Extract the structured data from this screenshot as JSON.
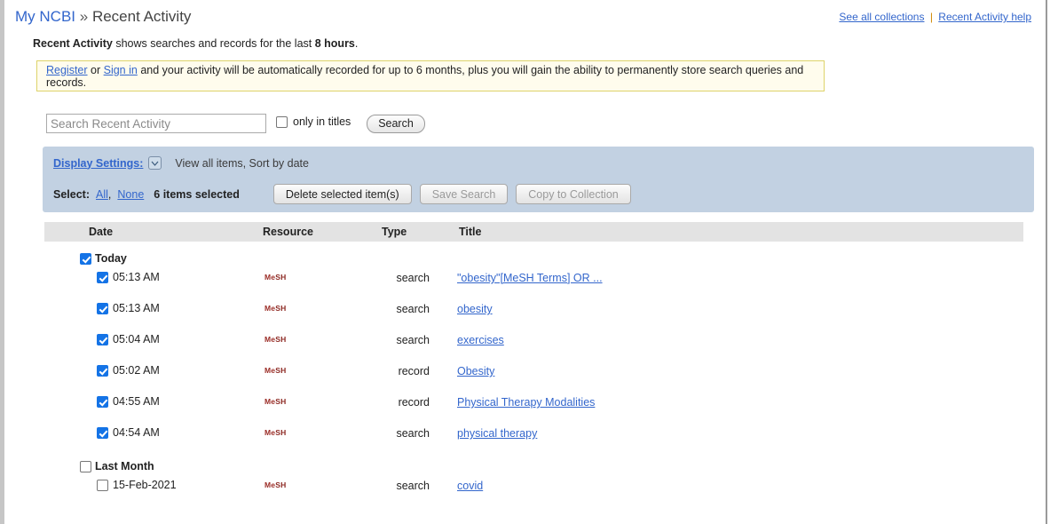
{
  "header": {
    "breadcrumb_root": "My NCBI",
    "breadcrumb_sep": "»",
    "breadcrumb_current": "Recent Activity",
    "see_all_collections": "See all collections",
    "link_separator": "|",
    "recent_activity_help": "Recent Activity help"
  },
  "blurb": {
    "strong_prefix": "Recent Activity",
    "middle": " shows searches and records for the last ",
    "strong_suffix": "8 hours",
    "period": "."
  },
  "notice": {
    "register": "Register",
    "or": " or ",
    "signin": "Sign in",
    "rest": " and your activity will be automatically recorded for up to 6 months, plus you will gain the ability to permanently store search queries and records."
  },
  "search": {
    "placeholder": "Search Recent Activity",
    "value": "",
    "only_in_titles_label": "only in titles",
    "only_in_titles_checked": false,
    "search_button": "Search"
  },
  "display_settings": {
    "link_label": "Display Settings:",
    "chevron_icon": "chevron-down-icon",
    "summary": "View all items, Sort by date",
    "select_label": "Select:",
    "select_all": "All",
    "select_comma": ",",
    "select_none": "None",
    "items_selected": "6 items selected",
    "delete_button": "Delete selected item(s)",
    "save_search_button": "Save Search",
    "copy_to_collection_button": "Copy to Collection"
  },
  "table": {
    "columns": [
      "Date",
      "Resource",
      "Type",
      "Title"
    ],
    "groups": [
      {
        "label": "Today",
        "checked": true,
        "rows": [
          {
            "checked": true,
            "date": "05:13 AM",
            "resource": "MeSH",
            "type": "search",
            "title": "\"obesity\"[MeSH Terms] OR ..."
          },
          {
            "checked": true,
            "date": "05:13 AM",
            "resource": "MeSH",
            "type": "search",
            "title": "obesity"
          },
          {
            "checked": true,
            "date": "05:04 AM",
            "resource": "MeSH",
            "type": "search",
            "title": "exercises"
          },
          {
            "checked": true,
            "date": "05:02 AM",
            "resource": "MeSH",
            "type": "record",
            "title": "Obesity"
          },
          {
            "checked": true,
            "date": "04:55 AM",
            "resource": "MeSH",
            "type": "record",
            "title": "Physical Therapy Modalities"
          },
          {
            "checked": true,
            "date": "04:54 AM",
            "resource": "MeSH",
            "type": "search",
            "title": "physical therapy"
          }
        ]
      },
      {
        "label": "Last Month",
        "checked": false,
        "rows": [
          {
            "checked": false,
            "date": "15-Feb-2021",
            "resource": "MeSH",
            "type": "search",
            "title": "covid"
          }
        ]
      }
    ]
  },
  "colors": {
    "link": "#3366cc",
    "panel_blue": "#c2d1e2",
    "header_gray": "#e3e3e3",
    "notice_yellow_bg": "#fffced",
    "notice_yellow_border": "#ded36a",
    "mesh_red": "#8c2822",
    "checkbox_blue": "#1473e6"
  }
}
